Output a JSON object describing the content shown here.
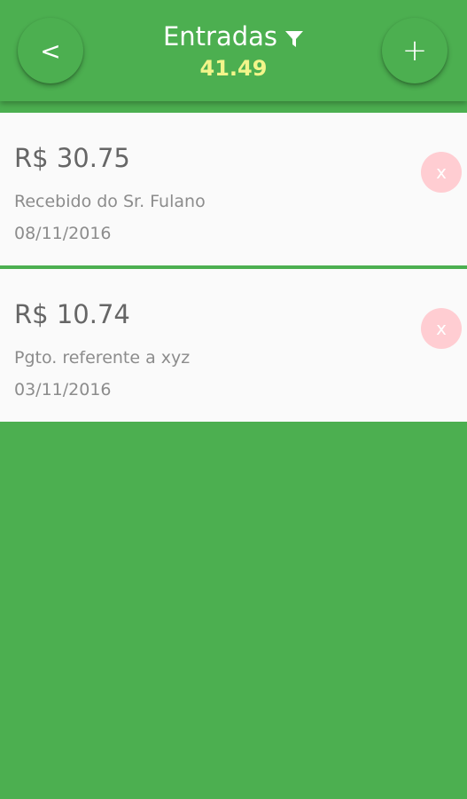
{
  "header": {
    "back_label": "<",
    "title": "Entradas",
    "total": "41.49",
    "add_label": "+"
  },
  "entries": [
    {
      "amount": "R$ 30.75",
      "description": "Recebido do Sr. Fulano",
      "date": "08/11/2016",
      "delete_label": "x"
    },
    {
      "amount": "R$ 10.74",
      "description": "Pgto. referente a xyz",
      "date": "03/11/2016",
      "delete_label": "x"
    }
  ],
  "colors": {
    "primary": "#4caf50",
    "total_text": "#f2f58a",
    "card_background": "#fafafa",
    "delete_button": "#ffcdd2"
  },
  "icons": {
    "filter": "filter-icon"
  }
}
